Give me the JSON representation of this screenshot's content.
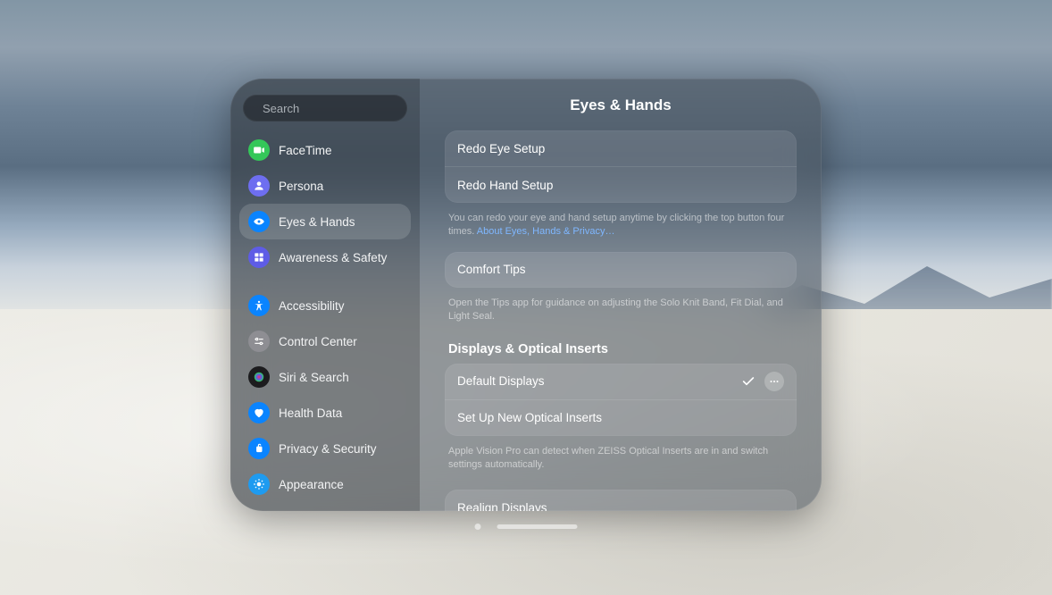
{
  "search": {
    "placeholder": "Search"
  },
  "sidebar": {
    "items": [
      {
        "label": "FaceTime",
        "icon": "video-icon",
        "color": "#34c759"
      },
      {
        "label": "Persona",
        "icon": "persona-icon",
        "color": "#6e6ef0"
      },
      {
        "label": "Eyes & Hands",
        "icon": "eye-hand-icon",
        "color": "#0a84ff",
        "selected": true
      },
      {
        "label": "Awareness & Safety",
        "icon": "awareness-icon",
        "color": "#5e5ce6"
      },
      {
        "label": "Accessibility",
        "icon": "accessibility-icon",
        "color": "#0a84ff"
      },
      {
        "label": "Control Center",
        "icon": "control-center-icon",
        "color": "#8e8e93"
      },
      {
        "label": "Siri & Search",
        "icon": "siri-icon",
        "color": "#1c1c1e"
      },
      {
        "label": "Health Data",
        "icon": "health-icon",
        "color": "#0a84ff"
      },
      {
        "label": "Privacy & Security",
        "icon": "privacy-icon",
        "color": "#0a84ff"
      },
      {
        "label": "Appearance",
        "icon": "appearance-icon",
        "color": "#1e9bf0"
      }
    ]
  },
  "page": {
    "title": "Eyes & Hands",
    "setup": {
      "rows": [
        "Redo Eye Setup",
        "Redo Hand Setup"
      ],
      "footer": "You can redo your eye and hand setup anytime by clicking the top button four times. ",
      "footer_link": "About Eyes, Hands & Privacy…"
    },
    "comfort": {
      "rows": [
        "Comfort Tips"
      ],
      "footer": "Open the Tips app for guidance on adjusting the Solo Knit Band, Fit Dial, and Light Seal."
    },
    "displays": {
      "header": "Displays & Optical Inserts",
      "rows": [
        {
          "label": "Default Displays",
          "checked": true,
          "more": true
        },
        {
          "label": "Set Up New Optical Inserts"
        }
      ],
      "footer": "Apple Vision Pro can detect when ZEISS Optical Inserts are in and switch settings automatically."
    },
    "realign": {
      "rows": [
        "Realign Displays"
      ]
    }
  }
}
